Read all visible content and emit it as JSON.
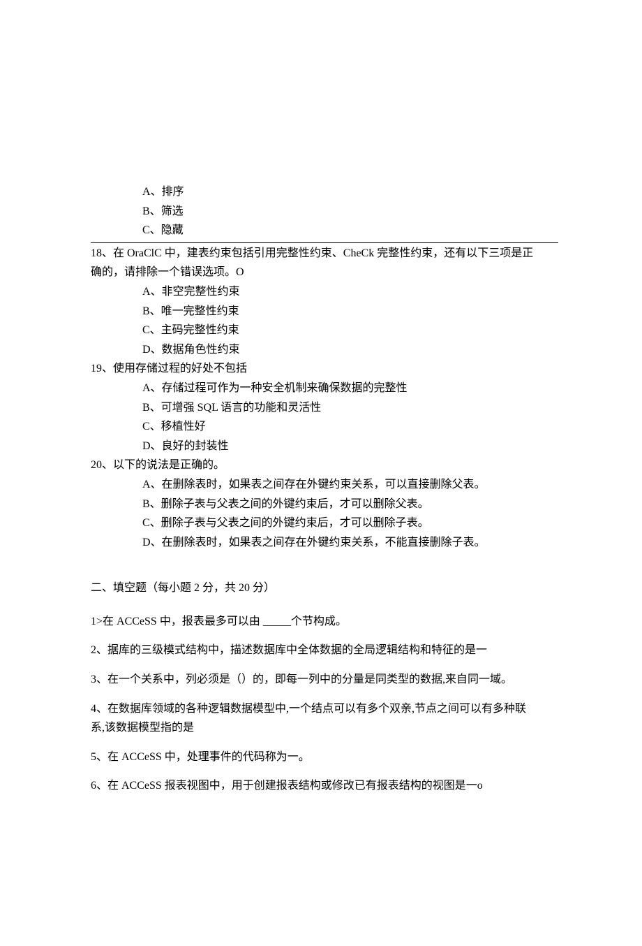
{
  "q17_options": {
    "a": "A、排序",
    "b": "B、筛选",
    "c": "C、隐藏"
  },
  "q18": {
    "stem_1": "18、在 OraClC 中，建表约束包括引用完整性约束、CheCk 完整性约束，还有以下三项是正",
    "stem_2": "确的，请排除一个错误选项。O",
    "a": "A、非空完整性约束",
    "b": "B、唯一完整性约束",
    "c": "C、主码完整性约束",
    "d": "D、数据角色性约束"
  },
  "q19": {
    "stem": "19、使用存储过程的好处不包括",
    "a": "A、存储过程可作为一种安全机制来确保数据的完整性",
    "b": "B、可增强 SQL 语言的功能和灵活性",
    "c": "C、移植性好",
    "d": "D、良好的封装性"
  },
  "q20": {
    "stem": "20、以下的说法是正确的。",
    "a": "A、在删除表时，如果表之间存在外键约束关系，可以直接删除父表。",
    "b": "B、删除子表与父表之间的外键约束后，才可以删除父表。",
    "c": "C、删除子表与父表之间的外键约束后，才可以删除子表。",
    "d": "D、在删除表时，如果表之间存在外键约束关系，不能直接删除子表。"
  },
  "section2_title": "二、填空题（每小题 2 分，共 20 分）",
  "fill": {
    "q1": "1>在 ACCeSS 中，报表最多可以由 _____个节构成。",
    "q2": "2、据库的三级模式结构中，描述数据库中全体数据的全局逻辑结构和特征的是一",
    "q3": "3、在一个关系中，列必须是（）的，即每一列中的分量是同类型的数据,来自同一域。",
    "q4_1": "4、在数据库领域的各种逻辑数据模型中,一个结点可以有多个双亲,节点之间可以有多种联",
    "q4_2": "系,该数据模型指的是",
    "q5": "5、在 ACCeSS 中，处理事件的代码称为一。",
    "q6": "6、在 ACCeSS 报表视图中，用于创建报表结构或修改已有报表结构的视图是一o"
  }
}
